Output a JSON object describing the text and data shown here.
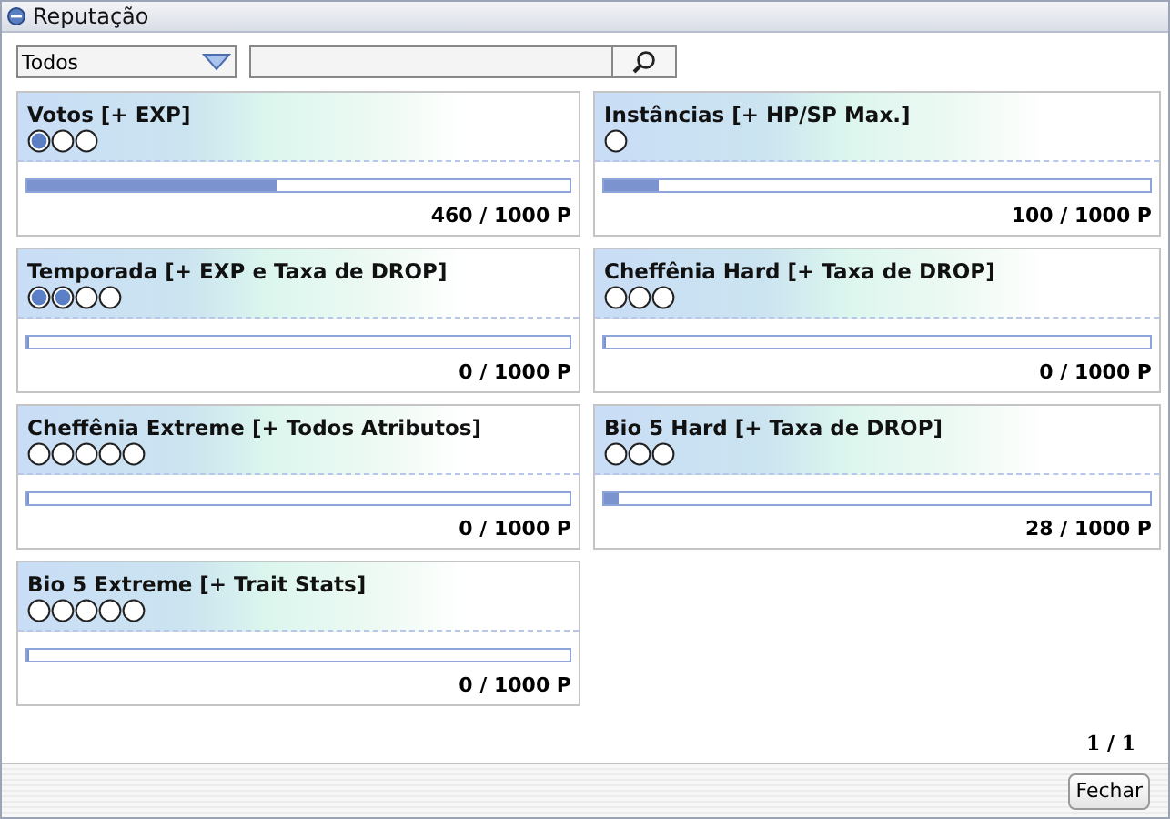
{
  "window": {
    "title": "Reputação"
  },
  "filter": {
    "value": "Todos"
  },
  "cards": [
    {
      "title": "Votos [+ EXP]",
      "ranks": [
        {
          "filled": true
        },
        {
          "filled": false
        },
        {
          "filled": false
        }
      ],
      "level": 0.46,
      "reading": "460 / 1000 P"
    },
    {
      "title": "Instâncias [+ HP/SP Max.]",
      "ranks": [
        {
          "filled": false
        }
      ],
      "level": 0.1,
      "reading": "100 / 1000 P"
    },
    {
      "title": "Temporada [+ EXP e Taxa de DROP]",
      "ranks": [
        {
          "filled": true
        },
        {
          "filled": true
        },
        {
          "filled": false
        },
        {
          "filled": false
        }
      ],
      "level": 0,
      "reading": "0 / 1000 P"
    },
    {
      "title": "Cheffênia Hard [+ Taxa de DROP]",
      "ranks": [
        {
          "filled": false
        },
        {
          "filled": false
        },
        {
          "filled": false
        }
      ],
      "level": 0,
      "reading": "0 / 1000 P"
    },
    {
      "title": "Cheffênia Extreme [+ Todos Atributos]",
      "ranks": [
        {
          "filled": false
        },
        {
          "filled": false
        },
        {
          "filled": false
        },
        {
          "filled": false
        },
        {
          "filled": false
        }
      ],
      "level": 0,
      "reading": "0 / 1000 P"
    },
    {
      "title": "Bio 5 Hard [+ Taxa de DROP]",
      "ranks": [
        {
          "filled": false
        },
        {
          "filled": false
        },
        {
          "filled": false
        }
      ],
      "level": 0.028,
      "reading": "28 / 1000 P"
    },
    {
      "title": "Bio 5 Extreme [+ Trait Stats]",
      "ranks": [
        {
          "filled": false
        },
        {
          "filled": false
        },
        {
          "filled": false
        },
        {
          "filled": false
        },
        {
          "filled": false
        }
      ],
      "level": 0,
      "reading": "0 / 1000 P"
    }
  ],
  "page": "1 / 1",
  "buttons": [
    "Fechar"
  ]
}
